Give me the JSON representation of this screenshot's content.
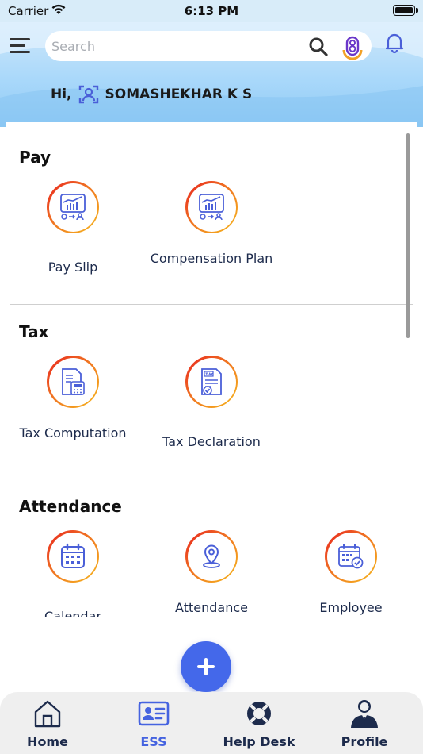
{
  "status_bar": {
    "carrier": "Carrier",
    "time": "6:13 PM"
  },
  "header": {
    "search": {
      "placeholder": "Search",
      "value": ""
    },
    "greeting": "Hi,",
    "user_name": "SOMASHEKHAR K S"
  },
  "sections": [
    {
      "title": "Pay",
      "items": [
        {
          "label": "Pay Slip",
          "icon": "payslip-icon"
        },
        {
          "label": "Compensation Plan",
          "icon": "compensation-plan-icon"
        }
      ]
    },
    {
      "title": "Tax",
      "items": [
        {
          "label": "Tax Computation",
          "icon": "tax-computation-icon"
        },
        {
          "label": "Tax Declaration",
          "icon": "tax-declaration-icon"
        }
      ]
    },
    {
      "title": "Attendance",
      "items": [
        {
          "label": "Calendar",
          "icon": "calendar-icon"
        },
        {
          "label": "Attendance",
          "icon": "location-pin-icon"
        },
        {
          "label": "Employee",
          "icon": "employee-calendar-icon"
        }
      ]
    }
  ],
  "bottom_nav": [
    {
      "label": "Home",
      "icon": "home-icon"
    },
    {
      "label": "ESS",
      "icon": "id-card-icon",
      "active": true
    },
    {
      "label": "Help Desk",
      "icon": "lifebuoy-icon"
    },
    {
      "label": "Profile",
      "icon": "user-profile-icon"
    }
  ],
  "colors": {
    "accent": "#4468ea",
    "nav_active": "#4563e0",
    "icon_ring_start": "#e8211f",
    "icon_ring_end": "#f6b81d",
    "label_text": "#1d2b4c",
    "header_bg": "#a9d8fa"
  }
}
